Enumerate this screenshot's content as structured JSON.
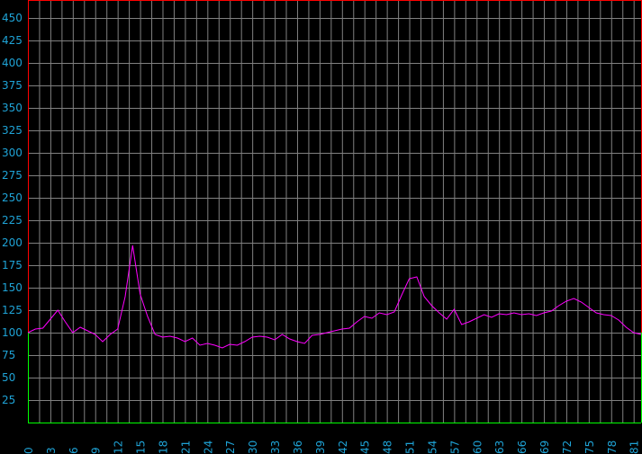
{
  "chart_data": {
    "type": "line",
    "title": "",
    "xlabel": "",
    "ylabel": "",
    "xlim": [
      0,
      82
    ],
    "ylim": [
      0,
      470
    ],
    "y_ticks": [
      25,
      50,
      75,
      100,
      125,
      150,
      175,
      200,
      225,
      250,
      275,
      300,
      325,
      350,
      375,
      400,
      425,
      450
    ],
    "x_ticks": [
      0,
      3,
      6,
      9,
      12,
      15,
      18,
      21,
      24,
      27,
      30,
      33,
      36,
      39,
      42,
      45,
      48,
      51,
      54,
      57,
      60,
      63,
      66,
      69,
      72,
      75,
      78,
      81
    ],
    "x_tick_labels": [
      "0",
      "3",
      "6",
      "9",
      "12",
      "15",
      "18",
      "21",
      "24",
      "27",
      "30",
      "33",
      "36",
      "39",
      "42",
      "45",
      "48",
      "51",
      "54",
      "57",
      "60",
      "63",
      "66",
      "69",
      "72",
      "75",
      "78",
      "81"
    ],
    "grid": true,
    "colors": {
      "background": "#000000",
      "grid": "#808080",
      "line": "#ff00ff",
      "tick_text": "#1fa3d6",
      "upper_band": "#ff0000",
      "lower_band": "#00ff00"
    },
    "band_threshold": 100,
    "series": [
      {
        "x": [
          0,
          1,
          2,
          3,
          4,
          5,
          6,
          7,
          8,
          9,
          10,
          11,
          12,
          13,
          14,
          15,
          16,
          17,
          18,
          19,
          20,
          21,
          22,
          23,
          24,
          25,
          26,
          27,
          28,
          29,
          30,
          31,
          32,
          33,
          34,
          35,
          36,
          37,
          38,
          39,
          40,
          41,
          42,
          43,
          44,
          45,
          46,
          47,
          48,
          49,
          50,
          51,
          52,
          53,
          54,
          55,
          56,
          57,
          58,
          59,
          60,
          61,
          62,
          63,
          64,
          65,
          66,
          67,
          68,
          69,
          70,
          71,
          72,
          73,
          74,
          75,
          76,
          77,
          78,
          79,
          80,
          81,
          82
        ],
        "values": [
          100,
          104,
          105,
          115,
          125,
          112,
          100,
          106,
          102,
          98,
          90,
          98,
          104,
          140,
          197,
          143,
          118,
          98,
          95,
          96,
          94,
          90,
          94,
          86,
          88,
          86,
          83,
          87,
          86,
          90,
          95,
          96,
          95,
          92,
          98,
          93,
          90,
          88,
          97,
          98,
          100,
          102,
          104,
          105,
          112,
          118,
          116,
          122,
          120,
          123,
          142,
          160,
          162,
          140,
          130,
          122,
          115,
          126,
          109,
          112,
          116,
          120,
          117,
          121,
          120,
          122,
          120,
          121,
          119,
          122,
          124,
          130,
          135,
          138,
          134,
          128,
          122,
          120,
          119,
          114,
          106,
          100,
          98
        ]
      }
    ]
  }
}
